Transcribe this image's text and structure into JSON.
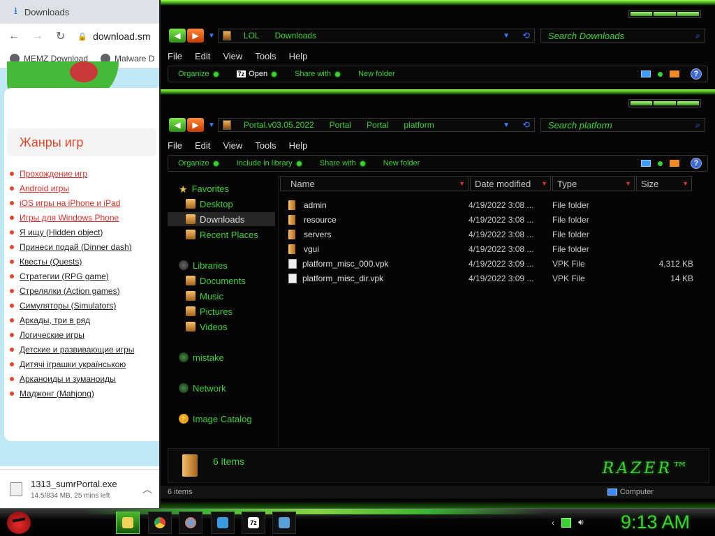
{
  "chrome": {
    "tab_title": "Downloads",
    "url": "download.sm",
    "bookmarks": [
      "MEMZ Download",
      "Malware D"
    ],
    "genres_title": "Жанры игр",
    "genres": [
      "Прохождение игр",
      "Android игры",
      "iOS игры на iPhone и iPad",
      "Игры для Windows Phone",
      "Я ищу (Hidden object)",
      "Принеси подай (Dinner dash)",
      "Квесты (Quests)",
      "Стратегии (RPG game)",
      "Стрелялки (Action games)",
      "Симуляторы (Simulators)",
      "Аркады, три в ряд",
      "Логические игры",
      "Детские и развивающие игры",
      "Дитячі іграшки українською",
      "Арканоиды и зуманоиды",
      "Маджонг (Mahjong)"
    ],
    "download": {
      "file": "1313_sumrPortal.exe",
      "progress": "14.5/834 MB, 25 mins left"
    }
  },
  "explorer_back": {
    "crumbs": [
      "LOL",
      "Downloads"
    ],
    "search_placeholder": "Search Downloads",
    "menu": [
      "File",
      "Edit",
      "View",
      "Tools",
      "Help"
    ],
    "commands": [
      "Organize",
      "Open",
      "Share with",
      "New folder"
    ]
  },
  "explorer": {
    "crumbs": [
      "Portal.v03.05.2022",
      "Portal",
      "Portal",
      "platform"
    ],
    "search_placeholder": "Search platform",
    "menu": [
      "File",
      "Edit",
      "View",
      "Tools",
      "Help"
    ],
    "commands": [
      "Organize",
      "Include in library",
      "Share with",
      "New folder"
    ],
    "nav": {
      "favorites": "Favorites",
      "desktop": "Desktop",
      "downloads": "Downloads",
      "recent": "Recent Places",
      "libraries": "Libraries",
      "documents": "Documents",
      "music": "Music",
      "pictures": "Pictures",
      "videos": "Videos",
      "homegroup": "mistake",
      "network": "Network",
      "image_catalog": "Image Catalog"
    },
    "columns": [
      "Name",
      "Date modified",
      "Type",
      "Size"
    ],
    "files": [
      {
        "name": "admin",
        "date": "4/19/2022 3:08 ...",
        "type": "File folder",
        "size": ""
      },
      {
        "name": "resource",
        "date": "4/19/2022 3:08 ...",
        "type": "File folder",
        "size": ""
      },
      {
        "name": "servers",
        "date": "4/19/2022 3:08 ...",
        "type": "File folder",
        "size": ""
      },
      {
        "name": "vgui",
        "date": "4/19/2022 3:08 ...",
        "type": "File folder",
        "size": ""
      },
      {
        "name": "platform_misc_000.vpk",
        "date": "4/19/2022 3:09 ...",
        "type": "VPK File",
        "size": "4,312 KB"
      },
      {
        "name": "platform_misc_dir.vpk",
        "date": "4/19/2022 3:09 ...",
        "type": "VPK File",
        "size": "14 KB"
      }
    ],
    "details_count": "6 items",
    "logo": "RAZER",
    "status_left": "6 items",
    "status_right": "Computer"
  },
  "taskbar": {
    "clock": "9:13 AM"
  },
  "colors": {
    "accent": "#3ed133",
    "glow": "#9bff4a",
    "background": "#050505"
  }
}
